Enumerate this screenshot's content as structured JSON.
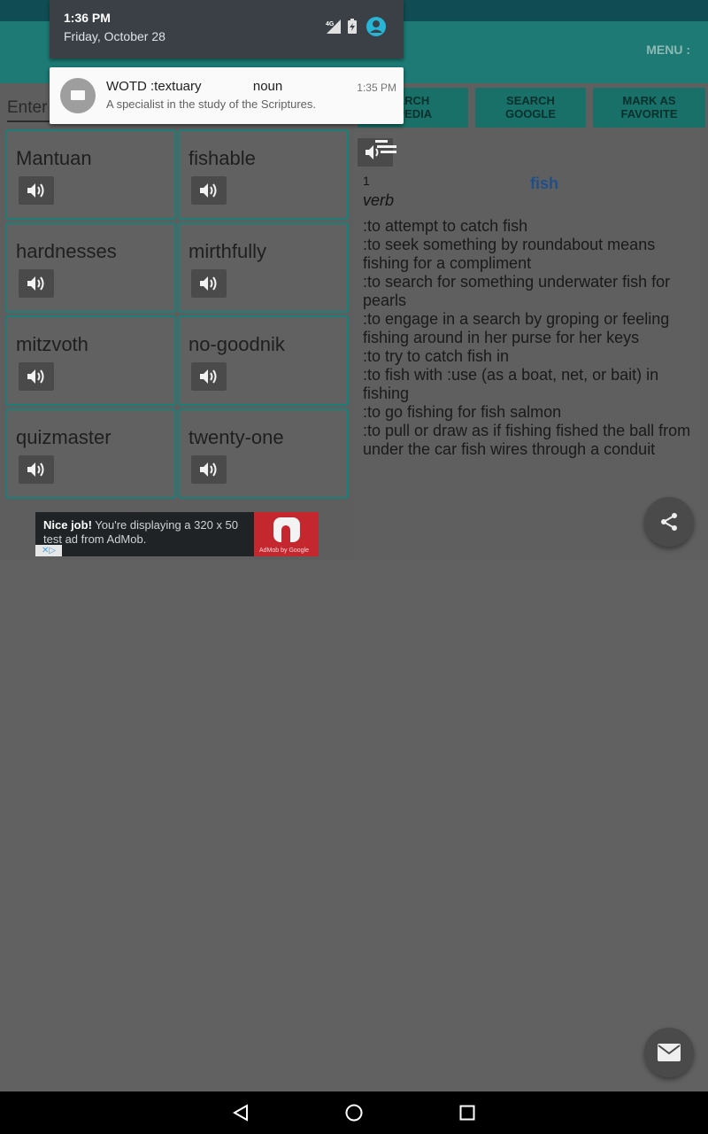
{
  "app": {
    "menu_label": "MENU :",
    "search_placeholder": "Enter",
    "buttons": [
      {
        "label": "SEARCH\nWIKIPEDIA",
        "display": "ARCH\nIPEDIA"
      },
      {
        "label": "SEARCH\nGOOGLE",
        "display": "SEARCH\nGOOGLE"
      },
      {
        "label": "MARK AS\nFAVORITE",
        "display": "MARK AS\nFAVORITE"
      }
    ],
    "words": [
      "Mantuan",
      "fishable",
      "hardnesses",
      "mirthfully",
      "mitzvoth",
      "no-goodnik",
      "quizmaster",
      "twenty-one"
    ]
  },
  "definition": {
    "sense_number": "1",
    "headword": "fish",
    "part_of_speech": "verb",
    "lines": [
      ":to attempt to catch fish",
      ":to seek something by roundabout means fishing for a compliment",
      ":to search for something underwater fish for pearls",
      ":to engage in a search by groping or feeling fishing around in her purse for her keys",
      ":to try to catch fish in",
      ":to fish with :use (as a boat, net, or bait) in fishing",
      ":to go fishing for fish salmon",
      ":to pull or draw as if fishing fished the ball from under the car fish wires through a conduit"
    ]
  },
  "ad": {
    "bold": "Nice job!",
    "text": " You're displaying a 320 x 50 test ad from AdMob.",
    "brand_caption": "AdMob by Google"
  },
  "status": {
    "time": "1:36 PM",
    "date": "Friday, October 28",
    "network": "4G"
  },
  "notification": {
    "title": "WOTD :textuary              noun",
    "time": "1:35 PM",
    "body": "A specialist in the study of the Scriptures."
  },
  "colors": {
    "teal": "#1d7a74",
    "dim_background": "#616161",
    "headword_blue": "#1f4f8a"
  }
}
